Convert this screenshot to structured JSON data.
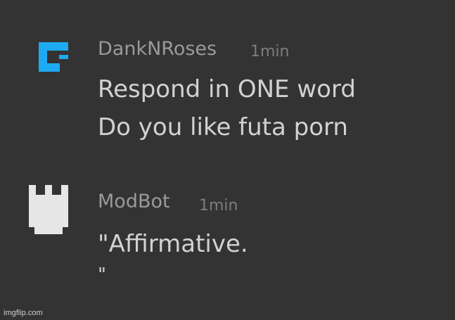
{
  "messages": [
    {
      "author": "DankNRoses",
      "time": "1min",
      "avatar_icon": "pixel-logo-icon",
      "avatar_color": "#1eaaf1",
      "lines": [
        "Respond in ONE word",
        "Do you like futa porn"
      ]
    },
    {
      "author": "ModBot",
      "time": "1min",
      "avatar_icon": "castle-tower-icon",
      "avatar_color": "#e6e6e6",
      "lines": [
        "\"Affirmative.",
        "\""
      ]
    }
  ],
  "watermark": "imgflip.com",
  "colors": {
    "background": "#333333",
    "username": "#9a9a9a",
    "timestamp": "#7d7d7d",
    "message_text": "#d2d2d2"
  }
}
